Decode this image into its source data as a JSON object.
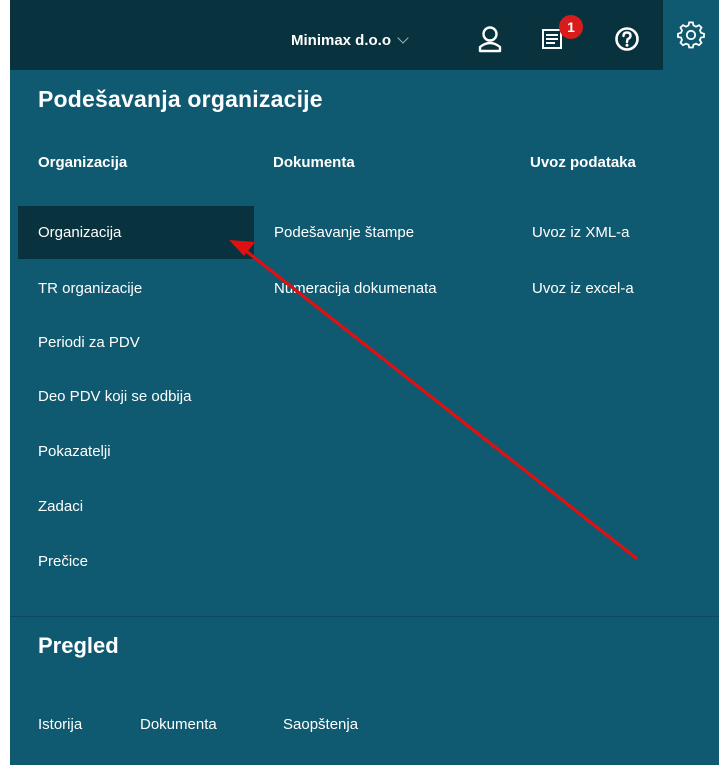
{
  "topbar": {
    "org_name": "Minimax d.o.o",
    "notification_count": "1",
    "icons": [
      "user-icon",
      "notifications-icon",
      "help-icon",
      "settings-icon"
    ]
  },
  "menu": {
    "title": "Podešavanja organizacije",
    "columns": [
      {
        "heading": "Organizacija",
        "items": [
          "Organizacija",
          "TR organizacije",
          "Periodi za PDV",
          "Deo PDV koji se odbija",
          "Pokazatelji",
          "Zadaci",
          "Prečice"
        ]
      },
      {
        "heading": "Dokumenta",
        "items": [
          "Podešavanje štampe",
          "Numeracija dokumenata"
        ]
      },
      {
        "heading": "Uvoz podataka",
        "items": [
          "Uvoz iz XML-a",
          "Uvoz iz excel-a"
        ]
      }
    ],
    "active_item": "Organizacija"
  },
  "pregled": {
    "title": "Pregled",
    "items": [
      "Istorija",
      "Dokumenta",
      "Saopštenja"
    ]
  },
  "colors": {
    "panel": "#0f5a70",
    "topbar": "#08323d",
    "active_item": "#08323d",
    "badge": "#d81b1b",
    "annotation_arrow": "#e01010"
  }
}
